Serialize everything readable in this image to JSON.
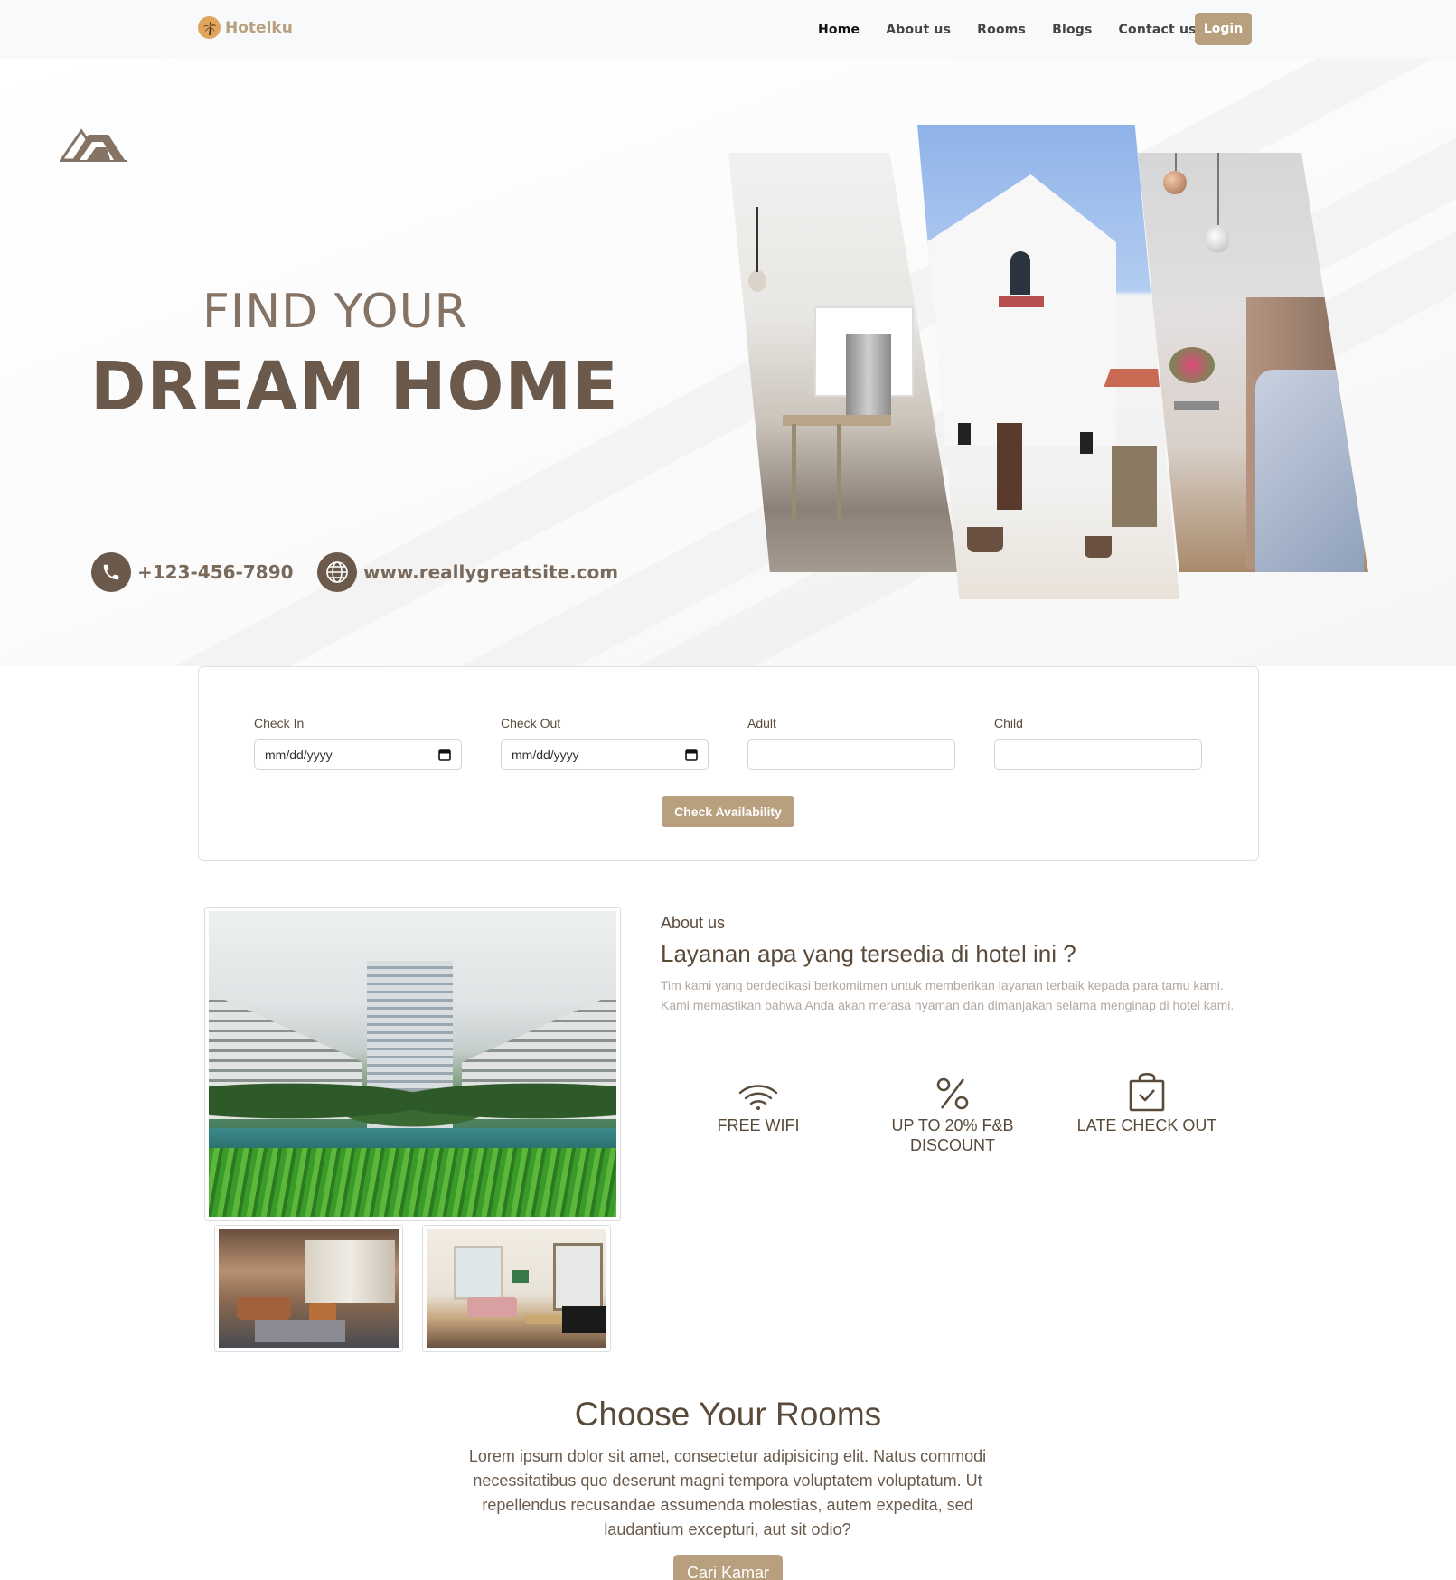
{
  "nav": {
    "brand": "Hotelku",
    "items": [
      "Home",
      "About us",
      "Rooms",
      "Blogs",
      "Contact us"
    ],
    "login": "Login"
  },
  "hero": {
    "title_line1": "FIND YOUR",
    "title_line2": "DREAM HOME",
    "phone": "+123-456-7890",
    "website": "www.reallygreatsite.com"
  },
  "booking": {
    "check_in_label": "Check In",
    "check_in_value": "mm/dd/yyyy",
    "check_out_label": "Check Out",
    "check_out_value": "mm/dd/yyyy",
    "adult_label": "Adult",
    "child_label": "Child",
    "button": "Check Availability"
  },
  "about": {
    "subtitle": "About us",
    "title": "Layanan apa yang tersedia di hotel ini ?",
    "description": "Tim kami yang berdedikasi berkomitmen untuk memberikan layanan terbaik kepada para tamu kami. Kami memastikan bahwa Anda akan merasa nyaman dan dimanjakan selama menginap di hotel kami.",
    "features": [
      {
        "icon": "wifi-icon",
        "label": "FREE WIFI"
      },
      {
        "icon": "percent-icon",
        "label": "UP TO 20% F&B DISCOUNT"
      },
      {
        "icon": "shopping-bag-check-icon",
        "label": "LATE CHECK OUT"
      }
    ]
  },
  "rooms": {
    "title": "Choose Your Rooms",
    "description": "Lorem ipsum dolor sit amet, consectetur adipisicing elit. Natus commodi necessitatibus quo deserunt magni tempora voluptatem voluptatum. Ut repellendus recusandae assumenda molestias, autem expedita, sed laudantium excepturi, aut sit odio?",
    "button": "Cari Kamar"
  },
  "colors": {
    "accent": "#b8a07e",
    "dark_brown": "#6b5a4c",
    "text": "#5a4a3a"
  }
}
